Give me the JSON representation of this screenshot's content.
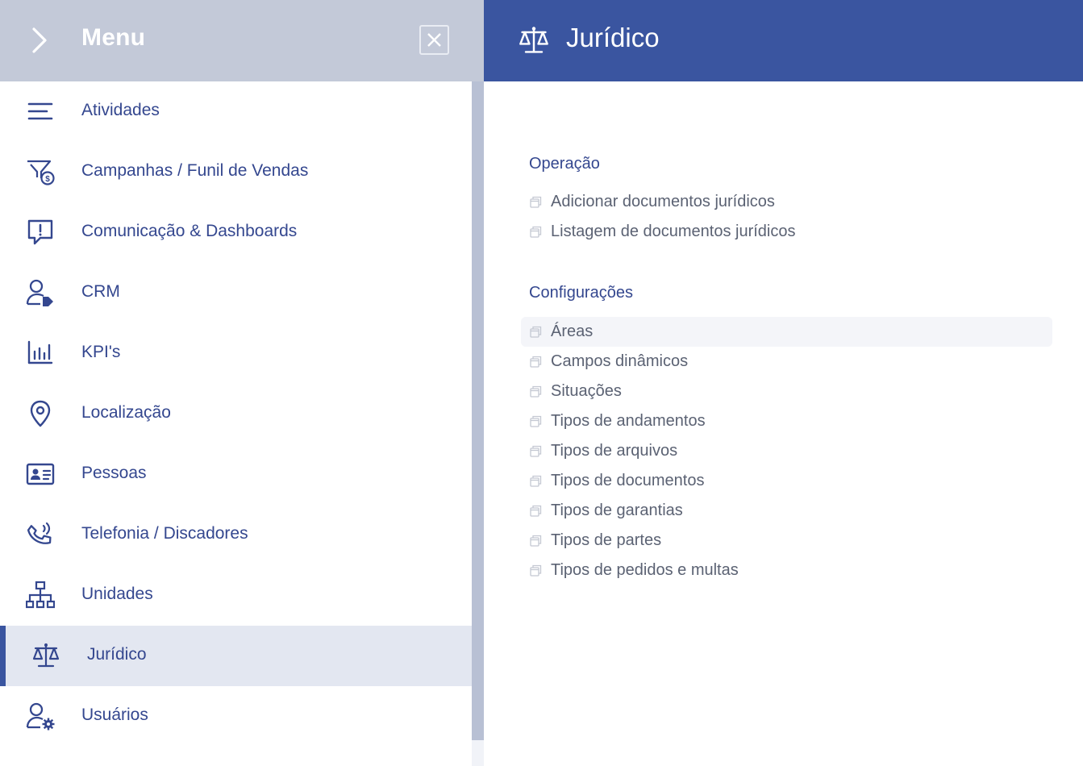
{
  "menu": {
    "title": "Menu",
    "items": [
      {
        "label": "Atividades",
        "icon": "list-icon"
      },
      {
        "label": "Campanhas / Funil de Vendas",
        "icon": "funnel-dollar-icon"
      },
      {
        "label": "Comunicação & Dashboards",
        "icon": "alert-message-icon"
      },
      {
        "label": "CRM",
        "icon": "user-tag-icon"
      },
      {
        "label": "KPI's",
        "icon": "bar-chart-icon"
      },
      {
        "label": "Localização",
        "icon": "map-pin-icon"
      },
      {
        "label": "Pessoas",
        "icon": "id-card-icon"
      },
      {
        "label": "Telefonia / Discadores",
        "icon": "phone-ringing-icon"
      },
      {
        "label": "Unidades",
        "icon": "org-chart-icon"
      },
      {
        "label": "Jurídico",
        "icon": "scales-icon",
        "active": true
      },
      {
        "label": "Usuários",
        "icon": "user-gear-icon"
      }
    ]
  },
  "panel": {
    "title": "Jurídico",
    "icon": "scales-icon",
    "sections": [
      {
        "title": "Operação",
        "links": [
          "Adicionar documentos jurídicos",
          "Listagem de documentos jurídicos"
        ]
      },
      {
        "title": "Configurações",
        "links": [
          "Áreas",
          "Campos dinâmicos",
          "Situações",
          "Tipos de andamentos",
          "Tipos de arquivos",
          "Tipos de documentos",
          "Tipos de garantias",
          "Tipos de partes",
          "Tipos de pedidos e multas"
        ]
      }
    ]
  },
  "colors": {
    "accent": "#3a55a0",
    "menu_header": "#c3c9d8",
    "menu_text": "#34478f",
    "link_text": "#5b6273",
    "active_bg": "#e3e7f1"
  }
}
